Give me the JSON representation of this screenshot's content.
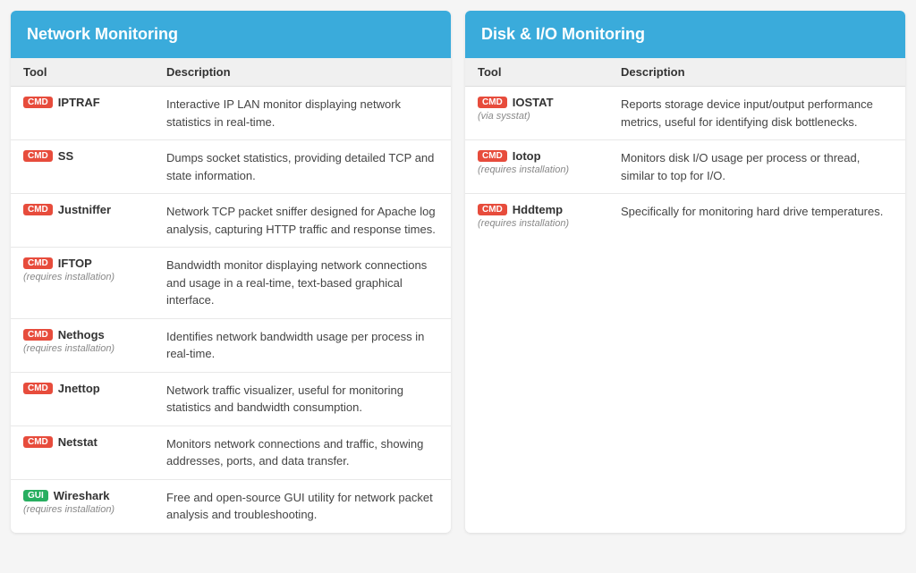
{
  "network": {
    "title": "Network Monitoring",
    "col_tool": "Tool",
    "col_desc": "Description",
    "rows": [
      {
        "badge": "CMD",
        "badge_type": "cmd",
        "name": "IPTRAF",
        "note": "",
        "desc": "Interactive IP LAN monitor displaying network statistics in real-time."
      },
      {
        "badge": "CMD",
        "badge_type": "cmd",
        "name": "SS",
        "note": "",
        "desc": "Dumps socket statistics, providing detailed TCP and state information."
      },
      {
        "badge": "CMD",
        "badge_type": "cmd",
        "name": "Justniffer",
        "note": "",
        "desc": "Network TCP packet sniffer designed for Apache log analysis, capturing HTTP traffic and response times."
      },
      {
        "badge": "CMD",
        "badge_type": "cmd",
        "name": "IFTOP",
        "note": "(requires installation)",
        "desc": "Bandwidth monitor displaying network connections and usage in a real-time, text-based graphical interface."
      },
      {
        "badge": "CMD",
        "badge_type": "cmd",
        "name": "Nethogs",
        "note": "(requires installation)",
        "desc": "Identifies network bandwidth usage per process in real-time."
      },
      {
        "badge": "CMD",
        "badge_type": "cmd",
        "name": "Jnettop",
        "note": "",
        "desc": "Network traffic visualizer, useful for monitoring statistics and bandwidth consumption."
      },
      {
        "badge": "CMD",
        "badge_type": "cmd",
        "name": "Netstat",
        "note": "",
        "desc": "Monitors network connections and traffic, showing addresses, ports, and data transfer."
      },
      {
        "badge": "GUI",
        "badge_type": "gui",
        "name": "Wireshark",
        "note": "(requires installation)",
        "desc": "Free and open-source GUI utility for network packet analysis and troubleshooting."
      }
    ]
  },
  "disk": {
    "title": "Disk & I/O Monitoring",
    "col_tool": "Tool",
    "col_desc": "Description",
    "rows": [
      {
        "badge": "CMD",
        "badge_type": "cmd",
        "name": "IOSTAT",
        "note": "(via sysstat)",
        "desc": "Reports storage device input/output performance metrics, useful for identifying disk bottlenecks."
      },
      {
        "badge": "CMD",
        "badge_type": "cmd",
        "name": "Iotop",
        "note": "(requires installation)",
        "desc": "Monitors disk I/O usage per process or thread, similar to top for I/O."
      },
      {
        "badge": "CMD",
        "badge_type": "cmd",
        "name": "Hddtemp",
        "note": "(requires installation)",
        "desc": "Specifically for monitoring hard drive temperatures."
      }
    ]
  },
  "colors": {
    "header_bg": "#3aabdb",
    "badge_cmd": "#e74c3c",
    "badge_gui": "#27ae60"
  }
}
